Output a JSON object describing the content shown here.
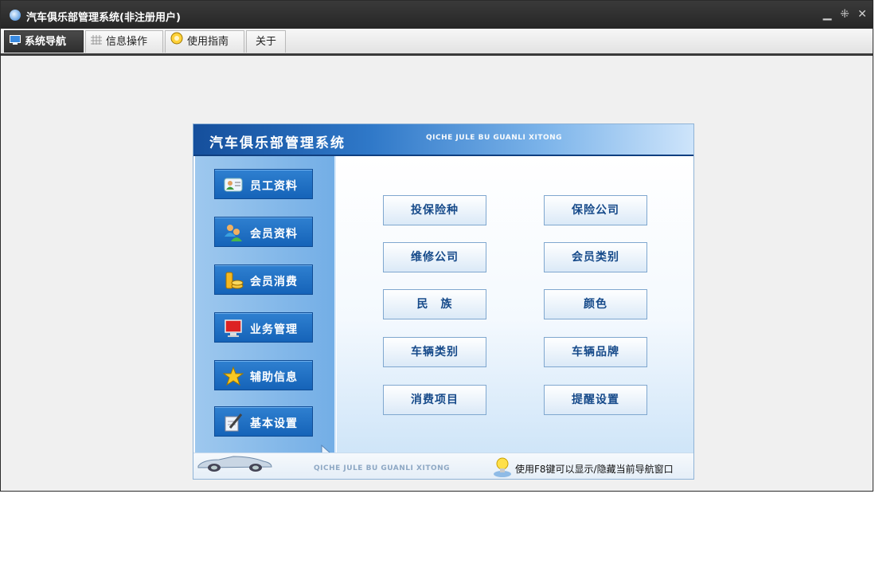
{
  "window": {
    "title": "汽车俱乐部管理系统(非注册用户)",
    "controls": [
      "minimize-icon",
      "restore-icon",
      "close-icon"
    ]
  },
  "tabs": [
    {
      "label": "系统导航",
      "icon": "monitor-icon",
      "active": true
    },
    {
      "label": "信息操作",
      "icon": "grid-icon",
      "active": false
    },
    {
      "label": "使用指南",
      "icon": "guide-icon",
      "active": false
    },
    {
      "label": "关于",
      "icon": "",
      "active": false
    }
  ],
  "panel": {
    "title": "汽车俱乐部管理系统",
    "subtitle": "QICHE JULE BU GUANLI XITONG",
    "sidebar": [
      {
        "label": "员工资料",
        "icon": "employee-card-icon"
      },
      {
        "label": "会员资料",
        "icon": "members-icon"
      },
      {
        "label": "会员消费",
        "icon": "coins-icon"
      },
      {
        "label": "业务管理",
        "icon": "monitor-icon"
      },
      {
        "label": "辅助信息",
        "icon": "star-icon"
      },
      {
        "label": "基本设置",
        "icon": "settings-pen-icon"
      }
    ],
    "buttons": [
      "投保险种",
      "保险公司",
      "维修公司",
      "会员类别",
      "民　族",
      "颜色",
      "车辆类别",
      "车辆品牌",
      "消费项目",
      "提醒设置"
    ],
    "footer": {
      "subtitle": "QICHE JULE BU GUANLI XITONG",
      "tip": "使用F8键可以显示/隐藏当前导航窗口"
    }
  },
  "colors": {
    "accent": "#1563b8",
    "header_dark": "#154f9c",
    "button_text": "#164a8a"
  }
}
